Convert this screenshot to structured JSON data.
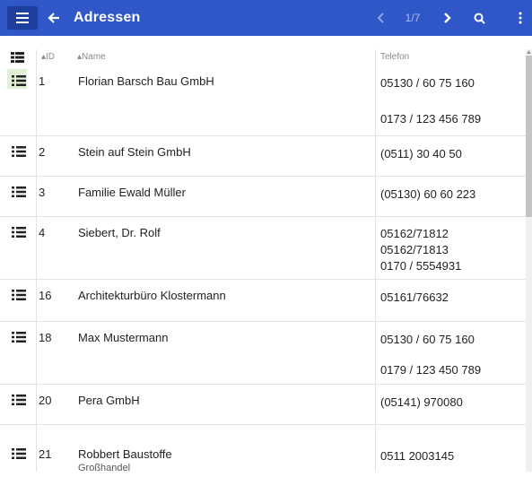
{
  "header": {
    "title": "Adressen",
    "page_info": "1/7",
    "icons": {
      "menu": "hamburger-menu-icon",
      "back": "arrow-left-icon",
      "prev": "chevron-left-icon",
      "next": "chevron-right-icon",
      "search": "search-icon",
      "more": "more-vertical-icon"
    },
    "colors": {
      "bar": "#2f57c7",
      "menu_button": "#1f3f9e",
      "active_row": "#dff0d5"
    }
  },
  "columns": {
    "id": "ID",
    "name": "Name",
    "phone": "Telefon"
  },
  "rows": [
    {
      "id": "1",
      "name": "Florian Barsch Bau GmbH",
      "phones": [
        "05130 / 60 75 160",
        "",
        "0173 / 123 456 789"
      ]
    },
    {
      "id": "2",
      "name": "Stein auf Stein GmbH",
      "phones": [
        "(0511) 30 40 50"
      ]
    },
    {
      "id": "3",
      "name": "Familie Ewald Müller",
      "phones": [
        "(05130) 60 60 223"
      ]
    },
    {
      "id": "4",
      "name": "Siebert, Dr. Rolf",
      "phones": [
        "05162/71812",
        "05162/71813",
        "0170 / 5554931"
      ]
    },
    {
      "id": "16",
      "name": "Architekturbüro Klostermann",
      "phones": [
        "05161/76632"
      ]
    },
    {
      "id": "18",
      "name": "Max Mustermann",
      "phones": [
        "05130 / 60 75 160",
        "",
        "0179 / 123 450 789"
      ]
    },
    {
      "id": "20",
      "name": "Pera GmbH",
      "phones": [
        "(05141) 970080"
      ]
    },
    {
      "id": "21",
      "name": "Robbert Baustoffe",
      "name_sub": "Großhandel",
      "phones": [
        "0511 2003145"
      ]
    }
  ]
}
